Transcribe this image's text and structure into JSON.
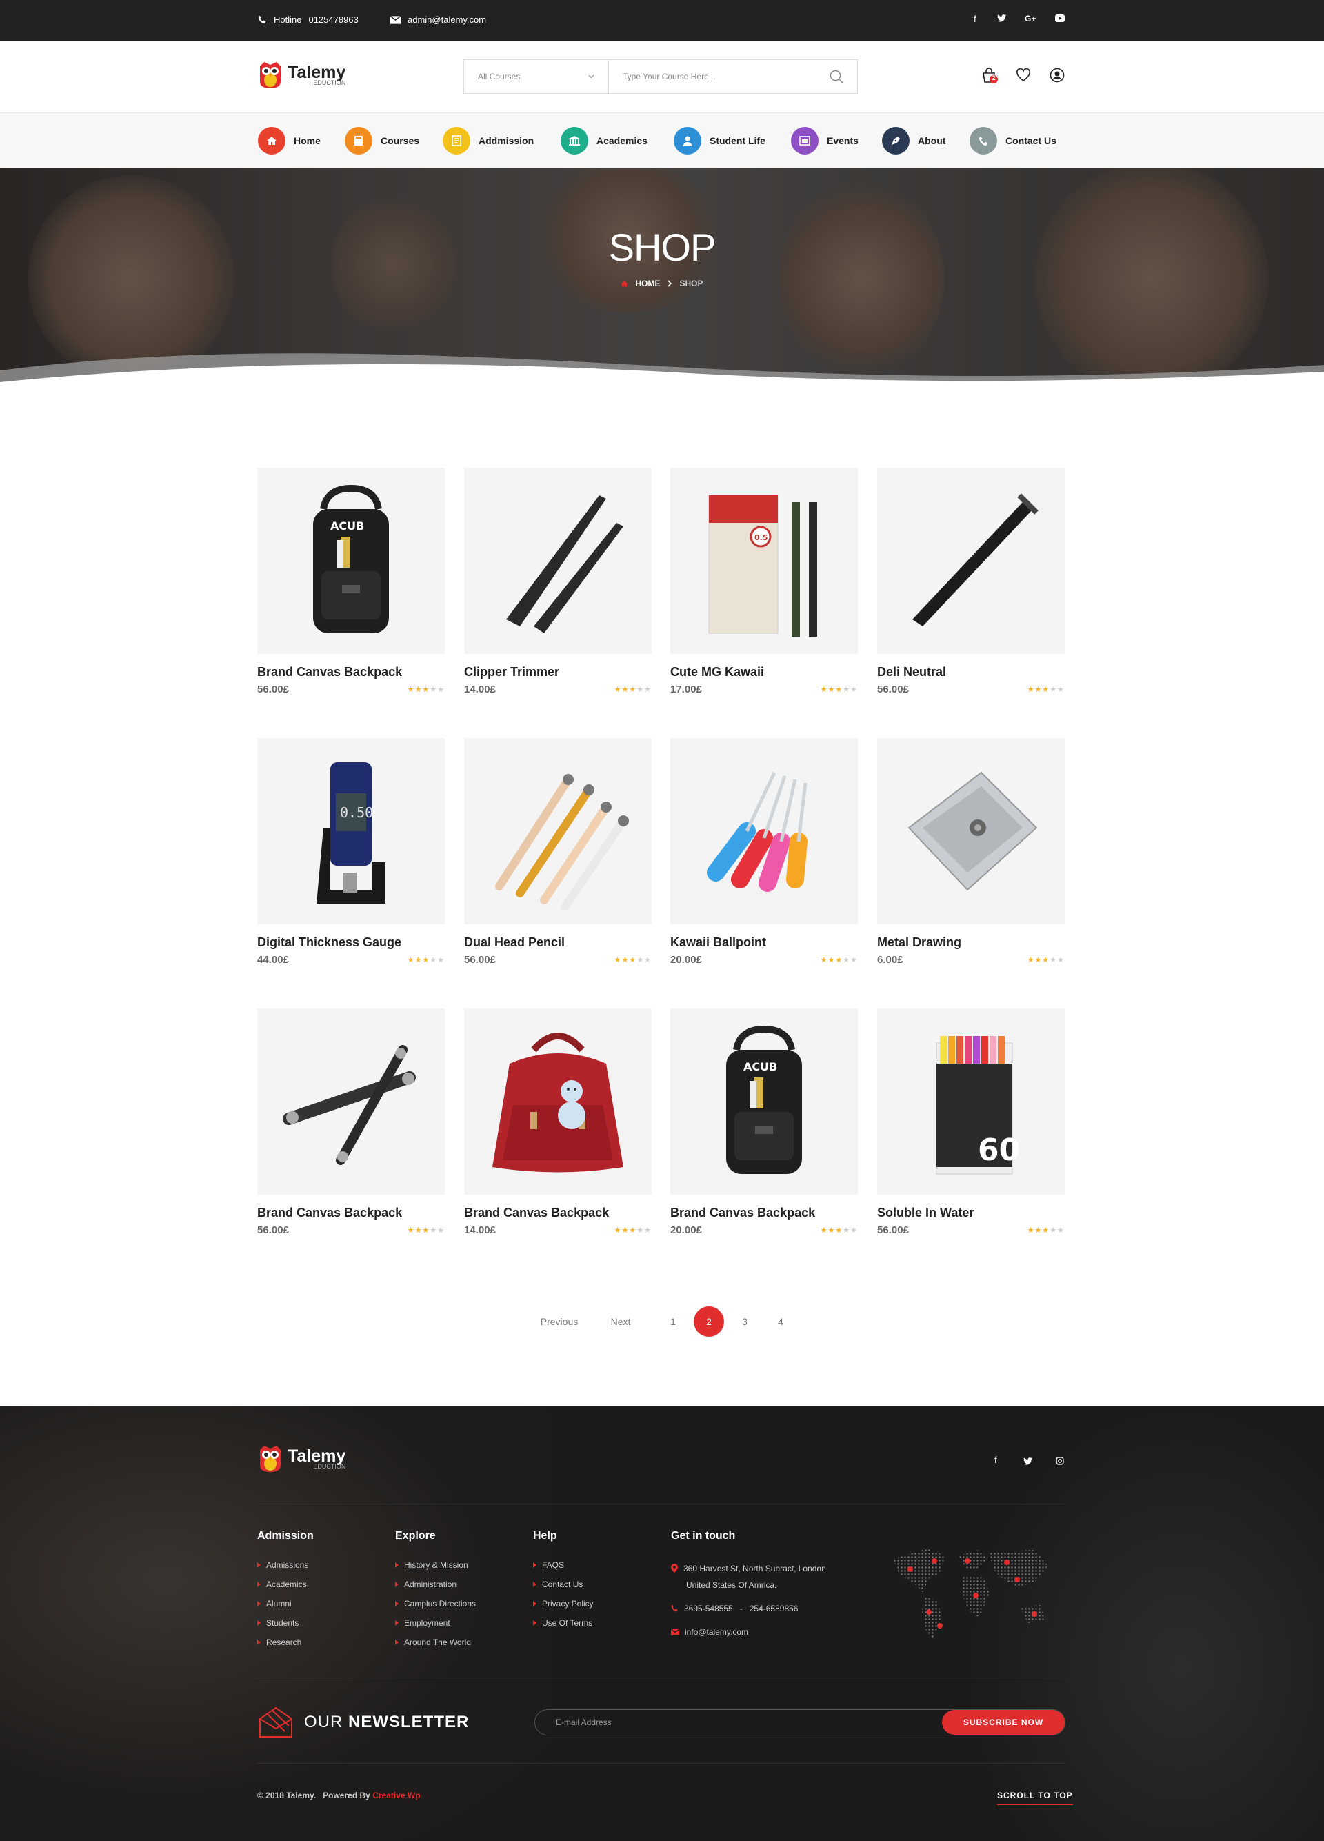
{
  "topbar": {
    "hotline_label": "Hotline",
    "hotline_number": "0125478963",
    "email": "admin@talemy.com"
  },
  "brand": {
    "name": "Talemy",
    "tagline": "EDUCTION"
  },
  "search": {
    "category_value": "All Courses",
    "placeholder": "Type Your Course Here..."
  },
  "header": {
    "cart_count": "2"
  },
  "nav": [
    {
      "label": "Home",
      "color": "#e8412e"
    },
    {
      "label": "Courses",
      "color": "#f28c1e"
    },
    {
      "label": "Addmission",
      "color": "#f2c21a"
    },
    {
      "label": "Academics",
      "color": "#1fae8c"
    },
    {
      "label": "Student Life",
      "color": "#2d8fd6"
    },
    {
      "label": "Events",
      "color": "#8e4fc4"
    },
    {
      "label": "About",
      "color": "#2b3a54"
    },
    {
      "label": "Contact Us",
      "color": "#8a9a9a"
    }
  ],
  "hero": {
    "title": "SHOP",
    "breadcrumb_home": "HOME",
    "breadcrumb_current": "SHOP"
  },
  "products": [
    {
      "title": "Brand Canvas Backpack",
      "price": "56.00£",
      "rating": 3,
      "icon": "black-backpack"
    },
    {
      "title": "Clipper Trimmer",
      "price": "14.00£",
      "rating": 3,
      "icon": "tweezers"
    },
    {
      "title": "Cute MG Kawaii",
      "price": "17.00£",
      "rating": 3,
      "icon": "pen-box"
    },
    {
      "title": "Deli Neutral",
      "price": "56.00£",
      "rating": 3,
      "icon": "pen"
    },
    {
      "title": "Digital Thickness Gauge",
      "price": "44.00£",
      "rating": 3,
      "icon": "gauge"
    },
    {
      "title": "Dual Head Pencil",
      "price": "56.00£",
      "rating": 3,
      "icon": "pencils"
    },
    {
      "title": "Kawaii Ballpoint",
      "price": "20.00£",
      "rating": 3,
      "icon": "screwdrivers"
    },
    {
      "title": "Metal Drawing",
      "price": "6.00£",
      "rating": 3,
      "icon": "sharpener"
    },
    {
      "title": "Brand Canvas Backpack",
      "price": "56.00£",
      "rating": 3,
      "icon": "pencil-holders"
    },
    {
      "title": "Brand Canvas Backpack",
      "price": "14.00£",
      "rating": 3,
      "icon": "red-backpack"
    },
    {
      "title": "Brand Canvas Backpack",
      "price": "20.00£",
      "rating": 3,
      "icon": "black-backpack"
    },
    {
      "title": "Soluble In Water",
      "price": "56.00£",
      "rating": 3,
      "icon": "marker-pack"
    }
  ],
  "pagination": {
    "previous": "Previous",
    "next": "Next",
    "pages": [
      "1",
      "2",
      "3",
      "4"
    ],
    "current": "2"
  },
  "footer": {
    "columns": [
      {
        "title": "Admission",
        "items": [
          "Admissions",
          "Academics",
          "Alumni",
          "Students",
          "Research"
        ]
      },
      {
        "title": "Explore",
        "items": [
          "History & Mission",
          "Administration",
          "Camplus Directions",
          "Employment",
          "Around The World"
        ]
      },
      {
        "title": "Help",
        "items": [
          "FAQS",
          "Contact Us",
          "Privacy Policy",
          "Use Of Terms"
        ]
      }
    ],
    "contact": {
      "title": "Get in touch",
      "address_line1": "360 Harvest St, North Subract, London.",
      "address_line2": "United States Of Amrica.",
      "phone": "3695-548555   -   254-6589856",
      "email": "info@talemy.com"
    },
    "newsletter": {
      "title_light": "OUR ",
      "title_bold": "NEWSLETTER",
      "placeholder": "E-mail Address",
      "button": "SUBSCRIBE NOW"
    },
    "copyright": "© 2018 Talemy.",
    "powered_by": "Powered By",
    "powered_by_name": "Creative Wp",
    "scroll_to_top": "SCROLL TO TOP"
  },
  "colors": {
    "accent": "#e12d2d",
    "star": "#f3b122",
    "dark": "#222222"
  }
}
